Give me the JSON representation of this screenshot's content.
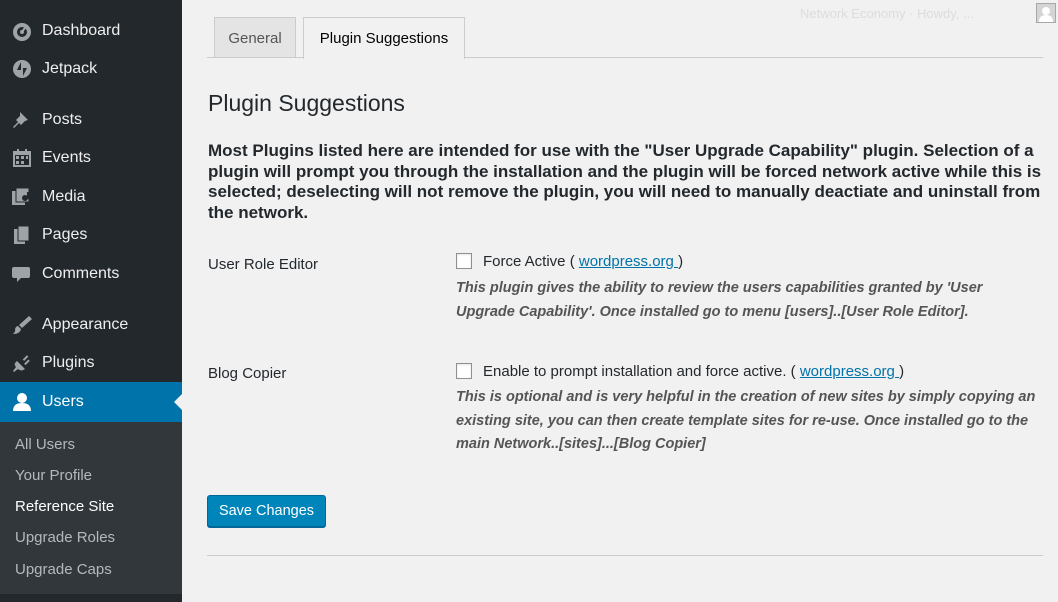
{
  "sidebar": {
    "menu": {
      "dashboard": {
        "label": "Dashboard",
        "icon": "dashboard-icon"
      },
      "jetpack": {
        "label": "Jetpack",
        "icon": "jetpack-icon"
      },
      "posts": {
        "label": "Posts",
        "icon": "pin-icon"
      },
      "events": {
        "label": "Events",
        "icon": "calendar-icon"
      },
      "media": {
        "label": "Media",
        "icon": "media-icon"
      },
      "pages": {
        "label": "Pages",
        "icon": "pages-icon"
      },
      "comments": {
        "label": "Comments",
        "icon": "comment-icon"
      },
      "appearance": {
        "label": "Appearance",
        "icon": "brush-icon"
      },
      "plugins": {
        "label": "Plugins",
        "icon": "plug-icon"
      },
      "users": {
        "label": "Users",
        "icon": "user-icon",
        "current": true
      }
    },
    "submenu": {
      "all_users": "All Users",
      "your_profile": "Your Profile",
      "reference_site": "Reference Site",
      "upgrade_roles": "Upgrade Roles",
      "upgrade_caps": "Upgrade Caps"
    },
    "colors": {
      "background": "#23282d",
      "submenu_background": "#32373c",
      "current": "#0073aa"
    }
  },
  "header": {
    "faded_text": "Network Economy · Howdy, ..."
  },
  "tabs": {
    "general": "General",
    "plugin_suggestions": "Plugin Suggestions",
    "active": "Plugin Suggestions"
  },
  "content": {
    "heading": "Plugin Suggestions",
    "description": "Most Plugins listed here are intended for use with the \"User Upgrade Capability\" plugin. Selection of a plugin will prompt you through the installation and the plugin will be forced network active while this is selected; deselecting will not remove the plugin, you will need to manually deactiate and uninstall from the network.",
    "rows": {
      "user_role_editor": {
        "label": "User Role Editor",
        "checkbox_prefix": "Force Active ( ",
        "link": "wordpress.org ",
        "checkbox_suffix": ")",
        "checked": false,
        "help": "This plugin gives the ability to review the users capabilities granted by 'User Upgrade Capability'. Once installed go to menu [users]..[User Role Editor]."
      },
      "blog_copier": {
        "label": "Blog Copier",
        "checkbox_prefix": "Enable to prompt installation and force active. ( ",
        "link": "wordpress.org ",
        "checkbox_suffix": ")",
        "checked": false,
        "help": "This is optional and is very helpful in the creation of new sites by simply copying an existing site, you can then create template sites for re-use. Once installed go to the main Network..[sites]...[Blog Copier]"
      }
    },
    "save_button": "Save Changes"
  },
  "colors": {
    "accent": "#0073aa",
    "button": "#0085ba",
    "page_background": "#f1f1f1"
  }
}
